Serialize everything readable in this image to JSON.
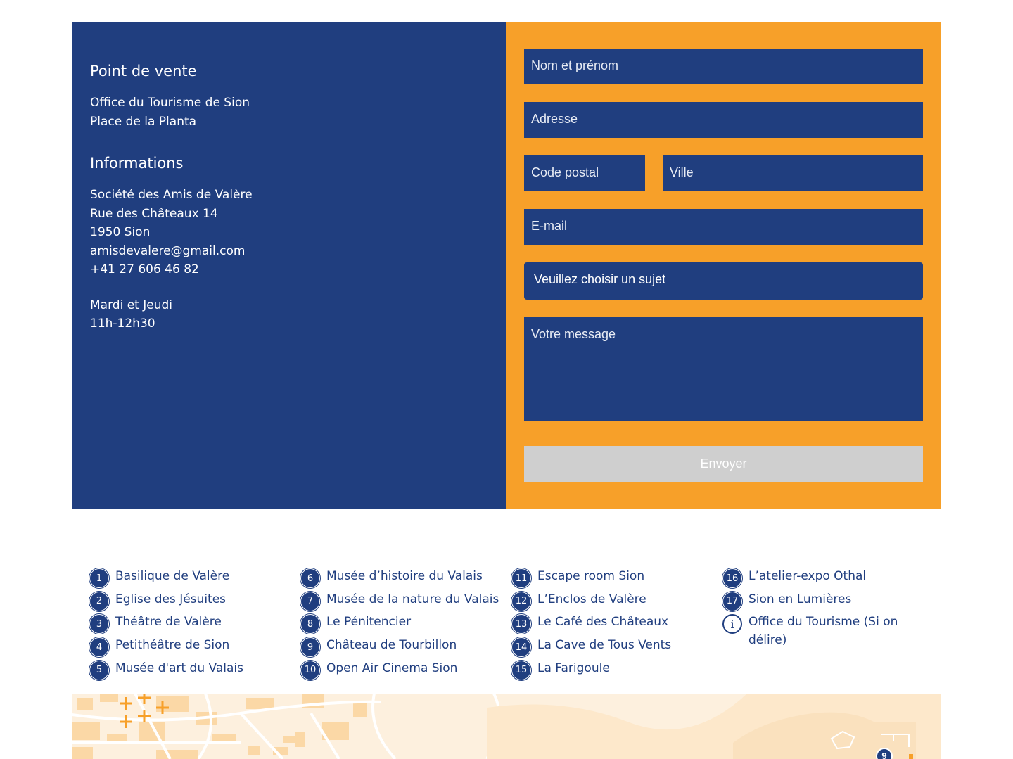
{
  "info": {
    "sale_heading": "Point de vente",
    "sale_lines": [
      "Office du Tourisme de Sion",
      "Place de la Planta"
    ],
    "info_heading": "Informations",
    "info_lines": [
      "Société des Amis de Valère",
      "Rue des Châteaux 14",
      "1950 Sion",
      "amisdevalere@gmail.com",
      "+41 27 606 46 82"
    ],
    "hours_lines": [
      "Mardi et Jeudi",
      "11h-12h30"
    ]
  },
  "form": {
    "name_placeholder": "Nom et prénom",
    "address_placeholder": "Adresse",
    "zip_placeholder": "Code postal",
    "city_placeholder": "Ville",
    "email_placeholder": "E-mail",
    "subject_selected": "Veuillez choisir un sujet",
    "message_placeholder": "Votre message",
    "submit_label": "Envoyer"
  },
  "legend": {
    "columns": [
      [
        {
          "num": "1",
          "label": "Basilique de Valère"
        },
        {
          "num": "2",
          "label": "Eglise des Jésuites"
        },
        {
          "num": "3",
          "label": "Théâtre de Valère"
        },
        {
          "num": "4",
          "label": "Petithéâtre de Sion"
        },
        {
          "num": "5",
          "label": "Musée d'art du Valais"
        }
      ],
      [
        {
          "num": "6",
          "label": "Musée d’histoire du Valais"
        },
        {
          "num": "7",
          "label": "Musée de la nature du Valais"
        },
        {
          "num": "8",
          "label": "Le Pénitencier"
        },
        {
          "num": "9",
          "label": "Château de Tourbillon"
        },
        {
          "num": "10",
          "label": "Open Air Cinema Sion"
        }
      ],
      [
        {
          "num": "11",
          "label": "Escape room Sion"
        },
        {
          "num": "12",
          "label": "L’Enclos de Valère"
        },
        {
          "num": "13",
          "label": "Le Café des Châteaux"
        },
        {
          "num": "14",
          "label": "La Cave de Tous Vents"
        },
        {
          "num": "15",
          "label": "La Farigoule"
        }
      ],
      [
        {
          "num": "16",
          "label": "L’atelier-expo Othal"
        },
        {
          "num": "17",
          "label": "Sion en Lumières"
        },
        {
          "num": "i",
          "label": "Office du Tourisme (Si on délire)"
        }
      ]
    ]
  },
  "map": {
    "marker_label": "9",
    "colors": {
      "land": "#fdf0de",
      "buildings": "#fbd8a6",
      "roads": "#ffffff",
      "accent": "#f7a029",
      "brand": "#203e7f"
    }
  },
  "colors": {
    "panel_blue": "#203e7f",
    "panel_orange": "#f7a029",
    "button_disabled": "#cfcfcf"
  }
}
